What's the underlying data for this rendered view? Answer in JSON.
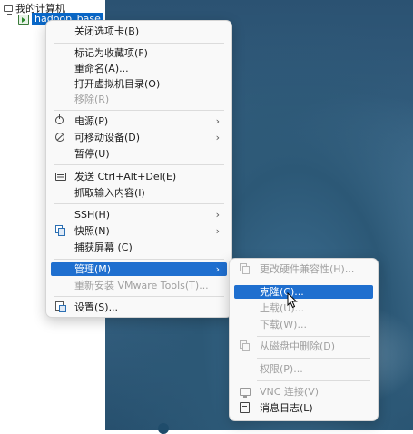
{
  "tree": {
    "root_label": "我的计算机",
    "vm_label": "hadoop_base"
  },
  "main_menu": {
    "close_tab": "关闭选项卡(B)",
    "mark_favorite": "标记为收藏项(F)",
    "rename": "重命名(A)...",
    "open_vm_dir": "打开虚拟机目录(O)",
    "remove": "移除(R)",
    "power": "电源(P)",
    "removable_devices": "可移动设备(D)",
    "pause": "暂停(U)",
    "send_cad": "发送 Ctrl+Alt+Del(E)",
    "grab_input": "抓取输入内容(I)",
    "ssh": "SSH(H)",
    "snapshot": "快照(N)",
    "capture_screen": "捕获屏幕 (C)",
    "manage": "管理(M)",
    "reinstall_tools": "重新安装 VMware Tools(T)...",
    "settings": "设置(S)..."
  },
  "sub_menu": {
    "change_compat": "更改硬件兼容性(H)...",
    "clone": "克隆(C)...",
    "upload": "上载(U)...",
    "download": "下载(W)...",
    "delete_from_disk": "从磁盘中删除(D)",
    "permissions": "权限(P)...",
    "vnc": "VNC 连接(V)",
    "message_log": "消息日志(L)"
  },
  "icons": {
    "power": "power-icon",
    "removable": "removable-devices-icon",
    "keyboard": "keyboard-icon",
    "snapshot": "snapshot-icon",
    "settings": "settings-icon",
    "compat": "hardware-compat-icon",
    "delete": "delete-disk-icon",
    "vnc": "vnc-monitor-icon",
    "log": "message-log-icon"
  },
  "colors": {
    "selection": "#1f6fcf",
    "tree_selection": "#0a68c8",
    "disabled_text": "#a0a0a0"
  }
}
